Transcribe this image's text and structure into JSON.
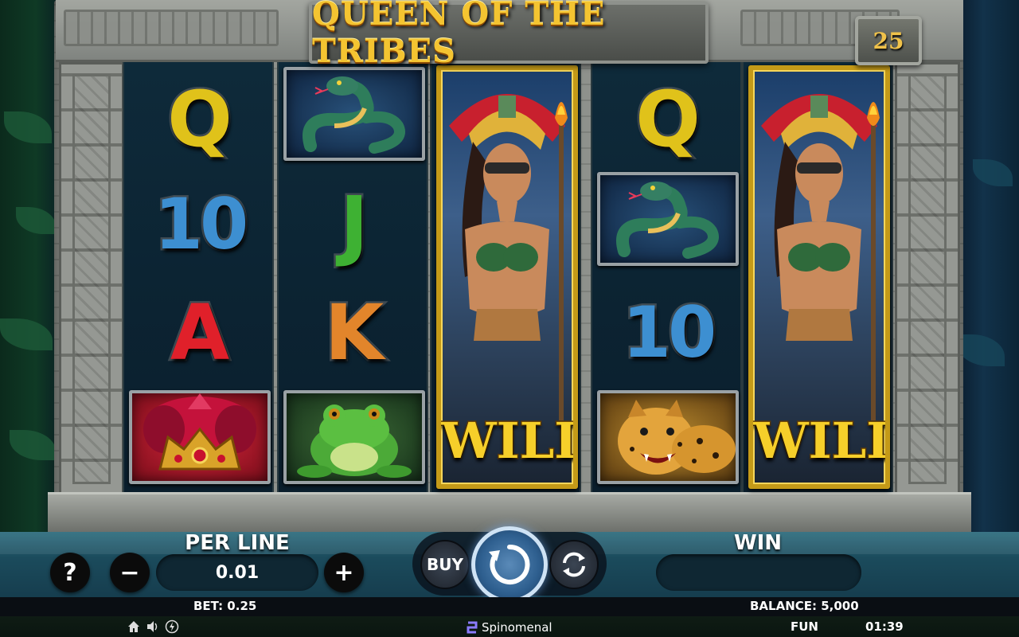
{
  "game": {
    "title": "QUEEN OF THE TRIBES",
    "lines_badge": "25"
  },
  "reels": [
    {
      "symbols": [
        "Q",
        "10",
        "A",
        "crown"
      ]
    },
    {
      "symbols": [
        "snake",
        "J",
        "K",
        "frog"
      ]
    },
    {
      "symbols": [
        "wild-queen"
      ],
      "wild_label": "WILD"
    },
    {
      "symbols": [
        "Q",
        "snake",
        "10",
        "jaguar"
      ]
    },
    {
      "symbols": [
        "wild-queen"
      ],
      "wild_label": "WILD"
    }
  ],
  "letters": {
    "r1_q": "Q",
    "r1_10": "10",
    "r1_a": "A",
    "r2_j": "J",
    "r2_k": "K",
    "r4_q": "Q",
    "r4_10": "10"
  },
  "colors": {
    "q": "#e0c21a",
    "ten": "#3d8fd1",
    "a": "#e0202a",
    "j": "#3eb133",
    "k": "#e2852b",
    "gold": "#f6cf2a"
  },
  "controls": {
    "help_label": "?",
    "per_line_label": "PER LINE",
    "per_line_value": "0.01",
    "minus_label": "−",
    "plus_label": "+",
    "buy_label": "BUY",
    "win_label": "WIN",
    "win_value": ""
  },
  "status": {
    "bet": "BET: 0.25",
    "balance": "BALANCE: 5,000",
    "mode": "FUN",
    "clock": "01:39",
    "brand": "Spinomenal"
  },
  "icons": [
    "home-icon",
    "sound-icon",
    "turbo-icon",
    "spin-icon",
    "autoplay-icon",
    "spinomenal-logo-icon"
  ]
}
